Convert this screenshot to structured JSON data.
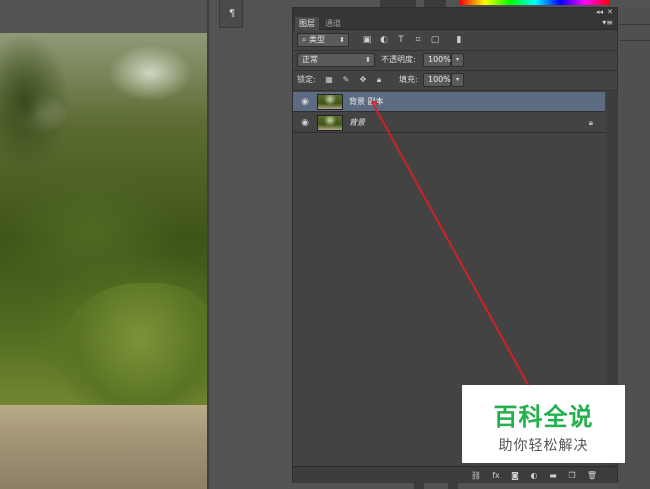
{
  "panel": {
    "tabs": [
      {
        "label": "图层",
        "active": true
      },
      {
        "label": "通道",
        "active": false
      }
    ],
    "filter": {
      "kind_label": "类型"
    },
    "blend_mode": "正常",
    "opacity": {
      "label": "不透明度:",
      "value": "100%"
    },
    "lock": {
      "label": "锁定:"
    },
    "fill": {
      "label": "填充:",
      "value": "100%"
    },
    "layers": [
      {
        "name": "背景 副本",
        "selected": true,
        "locked": false,
        "visible": true
      },
      {
        "name": "背景",
        "selected": false,
        "locked": true,
        "visible": true,
        "italic": true
      }
    ]
  },
  "watermark": {
    "title": "百科全说",
    "subtitle": "助你轻松解决",
    "color": "#22b14c"
  },
  "colors": {
    "selected_layer": "#5c6b82",
    "annotation_arrow": "#d0202a"
  }
}
